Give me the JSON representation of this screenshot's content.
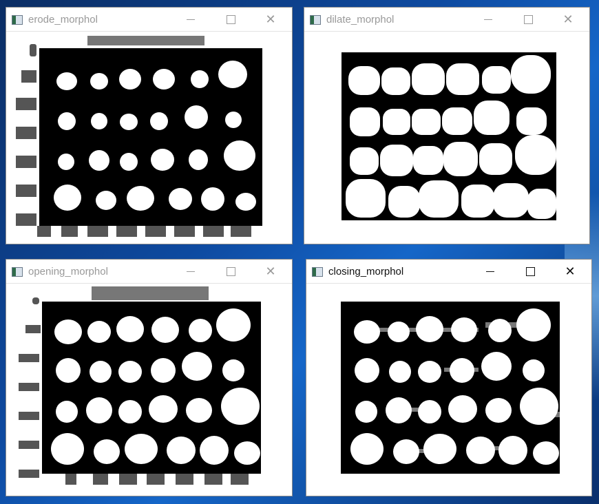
{
  "desktop": {
    "background": "#0e4aa0"
  },
  "windows": [
    {
      "id": "erode",
      "title": "erode_morphol",
      "active": false
    },
    {
      "id": "dilate",
      "title": "dilate_morphol",
      "active": false
    },
    {
      "id": "opening",
      "title": "opening_morphol",
      "active": false
    },
    {
      "id": "closing",
      "title": "closing_morphol",
      "active": true
    }
  ],
  "icons": {
    "app": "opencv-window-icon",
    "minimize": "minimize-icon",
    "maximize": "maximize-icon",
    "close": "close-icon"
  }
}
